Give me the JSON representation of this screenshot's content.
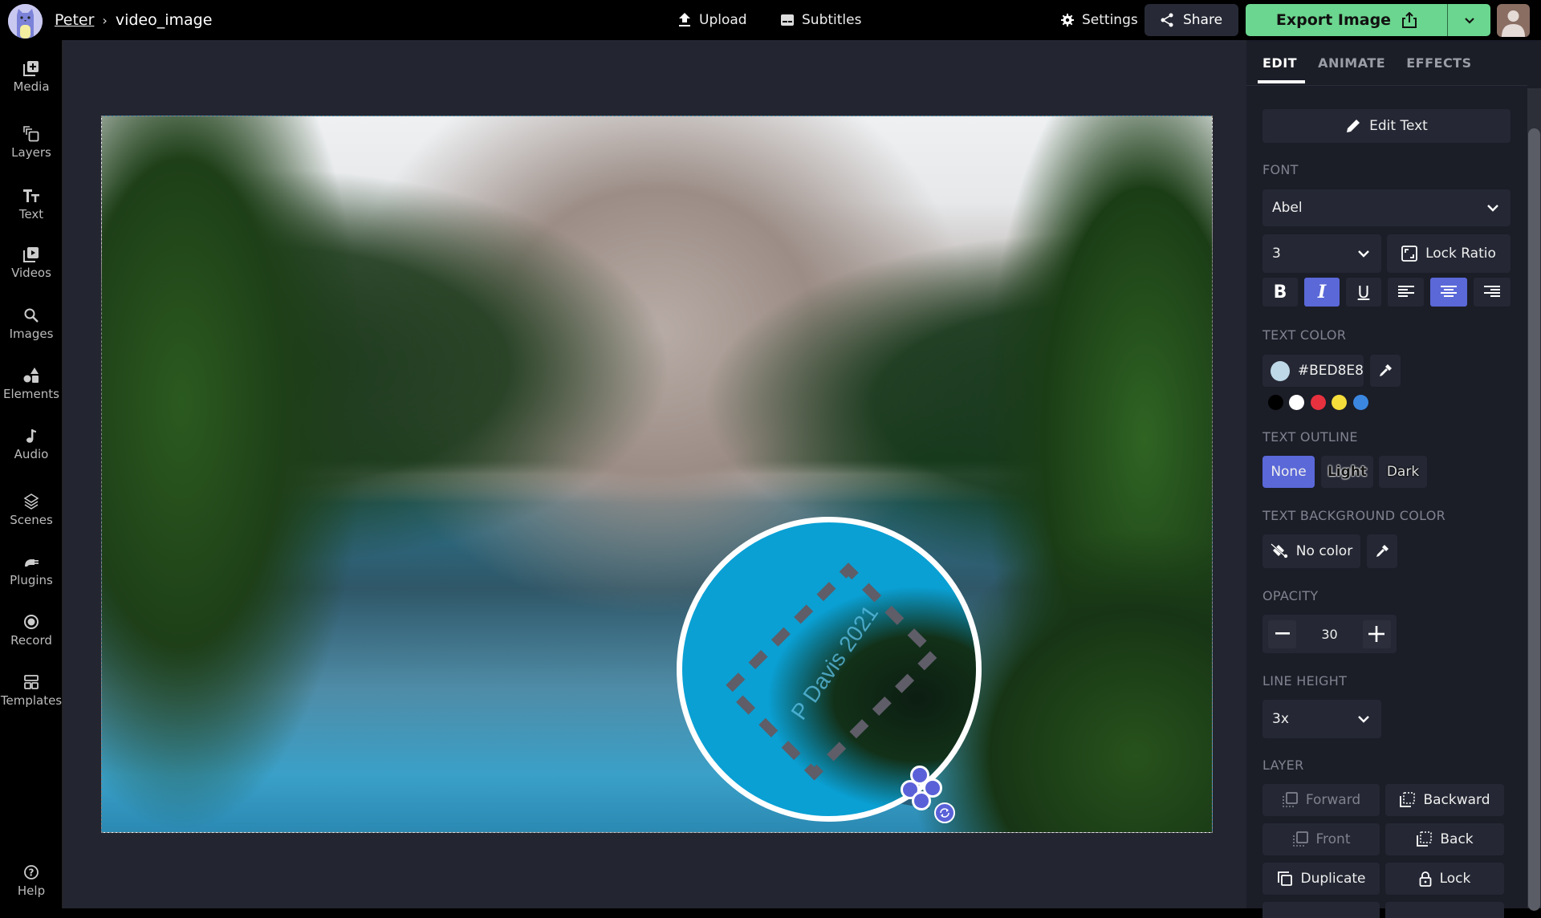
{
  "header": {
    "breadcrumb_parent": "Peter",
    "breadcrumb_separator": "›",
    "project_name": "video_image",
    "upload_label": "Upload",
    "subtitles_label": "Subtitles",
    "settings_label": "Settings",
    "share_label": "Share",
    "export_label": "Export Image"
  },
  "sidebar": {
    "items": [
      {
        "label": "Media",
        "icon": "media-plus-icon"
      },
      {
        "label": "Layers",
        "icon": "layers-icon"
      },
      {
        "label": "Text",
        "icon": "text-icon"
      },
      {
        "label": "Videos",
        "icon": "video-play-icon"
      },
      {
        "label": "Images",
        "icon": "search-icon"
      },
      {
        "label": "Elements",
        "icon": "shapes-icon"
      },
      {
        "label": "Audio",
        "icon": "music-note-icon"
      },
      {
        "label": "Scenes",
        "icon": "stack-icon"
      },
      {
        "label": "Plugins",
        "icon": "plug-icon"
      },
      {
        "label": "Record",
        "icon": "record-icon"
      },
      {
        "label": "Templates",
        "icon": "templates-icon"
      }
    ],
    "help_label": "Help"
  },
  "canvas": {
    "watermark_text": "P Davis 2021"
  },
  "panel": {
    "tabs": [
      "EDIT",
      "ANIMATE",
      "EFFECTS"
    ],
    "active_tab": "EDIT",
    "edit_text_label": "Edit Text",
    "font_heading": "FONT",
    "font_value": "Abel",
    "font_size_value": "3",
    "lock_ratio_label": "Lock Ratio",
    "format": {
      "bold": false,
      "italic": true,
      "underline": false,
      "align": "center"
    },
    "text_color_heading": "TEXT COLOR",
    "text_color_value": "#BED8E8",
    "preset_colors": [
      "#000000",
      "#ffffff",
      "#e8313f",
      "#f5dd3b",
      "#3b87e0"
    ],
    "text_outline_heading": "TEXT OUTLINE",
    "outline_options": [
      "None",
      "Light",
      "Dark"
    ],
    "outline_selected": "None",
    "text_bg_heading": "TEXT BACKGROUND COLOR",
    "text_bg_value": "No color",
    "opacity_heading": "OPACITY",
    "opacity_value": "30",
    "line_height_heading": "LINE HEIGHT",
    "line_height_value": "3x",
    "layer_heading": "LAYER",
    "layer_buttons": {
      "forward": "Forward",
      "backward": "Backward",
      "front": "Front",
      "back": "Back",
      "duplicate": "Duplicate",
      "lock": "Lock"
    }
  },
  "colors": {
    "accent": "#5a68d8",
    "export_green": "#6bd68f",
    "panel_bg": "#1b1d27",
    "canvas_bg": "#232530"
  }
}
